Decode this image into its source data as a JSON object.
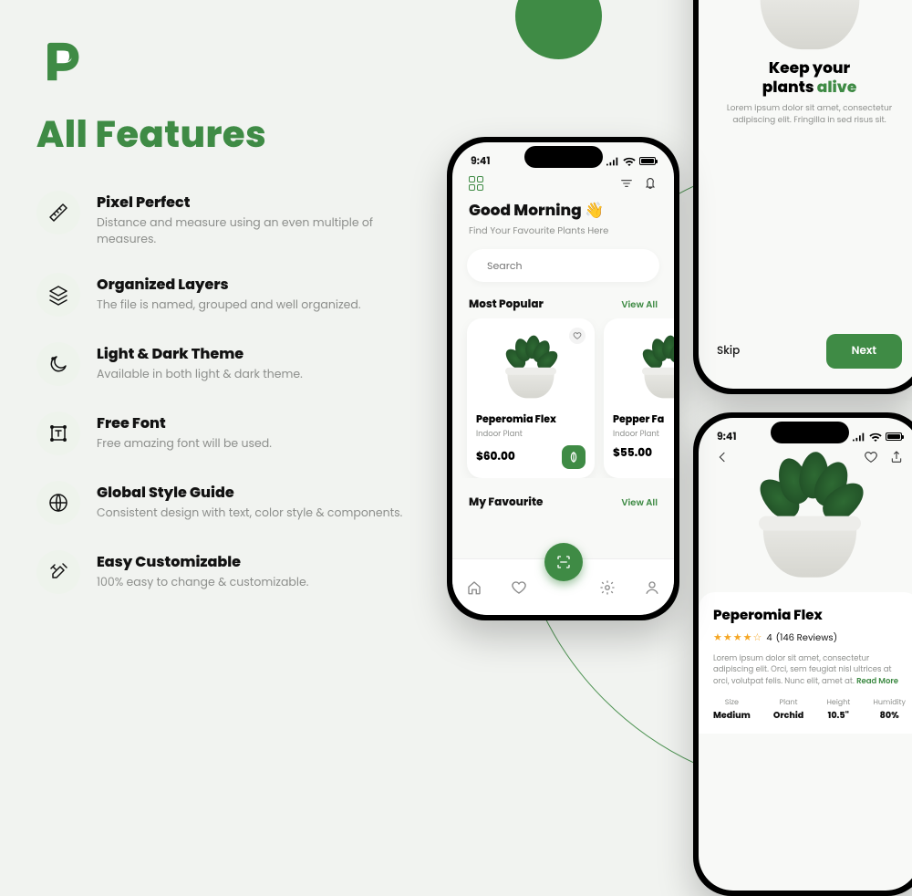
{
  "colors": {
    "green": "#3f8b45"
  },
  "left": {
    "title": "All Features",
    "features": [
      {
        "icon": "ruler",
        "h": "Pixel Perfect",
        "d": "Distance and measure using an even multiple of measures."
      },
      {
        "icon": "layers",
        "h": "Organized Layers",
        "d": "The file is named, grouped and well organized."
      },
      {
        "icon": "moon",
        "h": "Light & Dark Theme",
        "d": "Available in both light & dark theme."
      },
      {
        "icon": "text",
        "h": "Free Font",
        "d": "Free amazing font will be used."
      },
      {
        "icon": "globe",
        "h": "Global Style Guide",
        "d": "Consistent design with text, color style & components."
      },
      {
        "icon": "tools",
        "h": "Easy Customizable",
        "d": "100% easy to change & customizable."
      }
    ]
  },
  "phone_home": {
    "time": "9:41",
    "greeting": "Good Morning 👋",
    "subtitle": "Find Your Favourite Plants Here",
    "search_placeholder": "Search",
    "section_popular": "Most Popular",
    "section_fav": "My Favourite",
    "view_all": "View All",
    "cards": [
      {
        "name": "Peperomia Flex",
        "cat": "Indoor Plant",
        "price": "$60.00"
      },
      {
        "name": "Pepper Fa",
        "cat": "Indoor Plant",
        "price": "$55.00"
      }
    ]
  },
  "phone_onboard": {
    "title_line1": "Keep your",
    "title_line2a": "plants ",
    "title_line2b": "alive",
    "lorem": "Lorem ipsum dolor sit amet, consectetur adipiscing elit. Fringilla in sed risus sit.",
    "skip": "Skip",
    "next": "Next"
  },
  "phone_detail": {
    "time": "9:41",
    "name": "Peperomia Flex",
    "rating": "4",
    "reviews": "(146 Reviews)",
    "lorem": "Lorem ipsum dolor sit amet, consectetur adipiscing elit. Orci, sem feugiat nisl ultrices at orci, volutpat felis. Nunc elit, amet at. ",
    "read_more": "Read More",
    "specs": [
      {
        "l": "Size",
        "v": "Medium"
      },
      {
        "l": "Plant",
        "v": "Orchid"
      },
      {
        "l": "Height",
        "v": "10.5\""
      },
      {
        "l": "Humidity",
        "v": "80%"
      }
    ]
  }
}
